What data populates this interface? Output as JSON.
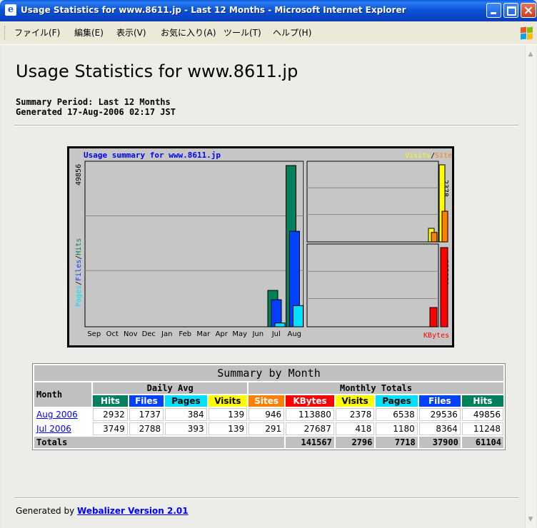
{
  "window": {
    "title": "Usage Statistics for www.8611.jp - Last 12 Months - Microsoft Internet Explorer",
    "app_icon": "ie-page-icon"
  },
  "menu": [
    "ファイル(F)",
    "編集(E)",
    "表示(V)",
    "お気に入り(A)",
    "ツール(T)",
    "ヘルプ(H)"
  ],
  "page": {
    "title": "Usage Statistics for www.8611.jp",
    "summary_period": "Summary Period: Last 12 Months",
    "generated": "Generated 17-Aug-2006 02:17 JST"
  },
  "chart_data": {
    "type": "bar",
    "title": "Usage summary for www.8611.jp",
    "categories": [
      "Sep",
      "Oct",
      "Nov",
      "Dec",
      "Jan",
      "Feb",
      "Mar",
      "Apr",
      "May",
      "Jun",
      "Jul",
      "Aug"
    ],
    "left_panel": {
      "axis_label": "Pages / Files / Hits",
      "axis_parts": [
        "Pages",
        "/",
        "Files",
        "/",
        "Hits"
      ],
      "max_label": "49856",
      "ymax": 49856,
      "series": [
        {
          "name": "Hits",
          "color": "#00805C",
          "values": [
            0,
            0,
            0,
            0,
            0,
            0,
            0,
            0,
            0,
            0,
            11248,
            49856
          ]
        },
        {
          "name": "Files",
          "color": "#0040FF",
          "values": [
            0,
            0,
            0,
            0,
            0,
            0,
            0,
            0,
            0,
            0,
            8364,
            29536
          ]
        },
        {
          "name": "Pages",
          "color": "#00E0FF",
          "values": [
            0,
            0,
            0,
            0,
            0,
            0,
            0,
            0,
            0,
            0,
            1180,
            6538
          ]
        }
      ]
    },
    "right_top_panel": {
      "legend": [
        "Visits",
        "/",
        "Sites"
      ],
      "max_label": "2378",
      "ymax": 2378,
      "series": [
        {
          "name": "Visits",
          "color": "#FFFF00",
          "values": [
            418,
            2378
          ]
        },
        {
          "name": "Sites",
          "color": "#FF8000",
          "values": [
            291,
            946
          ]
        }
      ]
    },
    "right_bottom_panel": {
      "legend": "KBytes",
      "max_label": "113880",
      "ymax": 113880,
      "series": [
        {
          "name": "KBytes",
          "color": "#FF0000",
          "values": [
            27687,
            113880
          ]
        }
      ]
    }
  },
  "table": {
    "caption": "Summary by Month",
    "month_header": "Month",
    "daily_avg_header": "Daily Avg",
    "monthly_totals_header": "Monthly Totals",
    "columns": [
      "Hits",
      "Files",
      "Pages",
      "Visits",
      "Sites",
      "KBytes",
      "Visits",
      "Pages",
      "Files",
      "Hits"
    ],
    "rows": [
      {
        "month": "Aug 2006",
        "values": [
          "2932",
          "1737",
          "384",
          "139",
          "946",
          "113880",
          "2378",
          "6538",
          "29536",
          "49856"
        ]
      },
      {
        "month": "Jul 2006",
        "values": [
          "3749",
          "2788",
          "393",
          "139",
          "291",
          "27687",
          "418",
          "1180",
          "8364",
          "11248"
        ]
      }
    ],
    "totals_label": "Totals",
    "totals": [
      "141567",
      "2796",
      "7718",
      "37900",
      "61104"
    ]
  },
  "footer": {
    "prefix": "Generated by ",
    "link": "Webalizer Version 2.01"
  }
}
